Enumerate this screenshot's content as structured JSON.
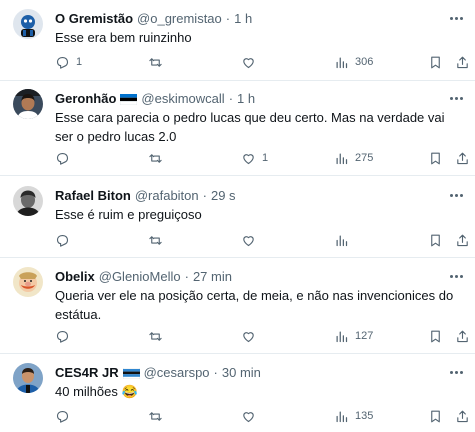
{
  "tweets": [
    {
      "name": "O Gremistão",
      "handle": "@o_gremistao",
      "time": "1 h",
      "text": "Esse era bem ruinzinho",
      "replies": "1",
      "retweets": "",
      "likes": "",
      "views": "306",
      "avatar": "gremio-mascot-avatar"
    },
    {
      "name": "Geronhão",
      "handle": "@eskimowcall",
      "time": "1 h",
      "text": "Esse cara parecia o pedro lucas que deu certo. Mas na verdade vai ser o pedro lucas 2.0",
      "replies": "",
      "retweets": "",
      "likes": "1",
      "views": "275",
      "flag": "estonia-flag-icon",
      "avatar": "person-avatar"
    },
    {
      "name": "Rafael Biton",
      "handle": "@rafabiton",
      "time": "29 s",
      "text": "Esse é ruim e preguiçoso",
      "replies": "",
      "retweets": "",
      "likes": "",
      "views": "",
      "avatar": "person-avatar"
    },
    {
      "name": "Obelix",
      "handle": "@GlenioMello",
      "time": "27 min",
      "text": "Queria ver ele na posição certa, de meia, e não nas invencionices do estátua.",
      "replies": "",
      "retweets": "",
      "likes": "",
      "views": "127",
      "avatar": "obelix-avatar"
    },
    {
      "name": "CES4R JR",
      "handle": "@cesarspo",
      "time": "30 min",
      "text": "40 milhões 😂",
      "replies": "",
      "retweets": "",
      "likes": "",
      "views": "135",
      "flag": "gremio-flag-icon",
      "avatar": "person-avatar"
    }
  ],
  "separator": "·",
  "colors": {
    "text": "#0f1419",
    "secondary": "#536471",
    "divider": "#e6ecf0"
  },
  "icons": [
    "reply-icon",
    "retweet-icon",
    "like-icon",
    "views-icon",
    "bookmark-icon",
    "share-icon",
    "more-icon"
  ]
}
